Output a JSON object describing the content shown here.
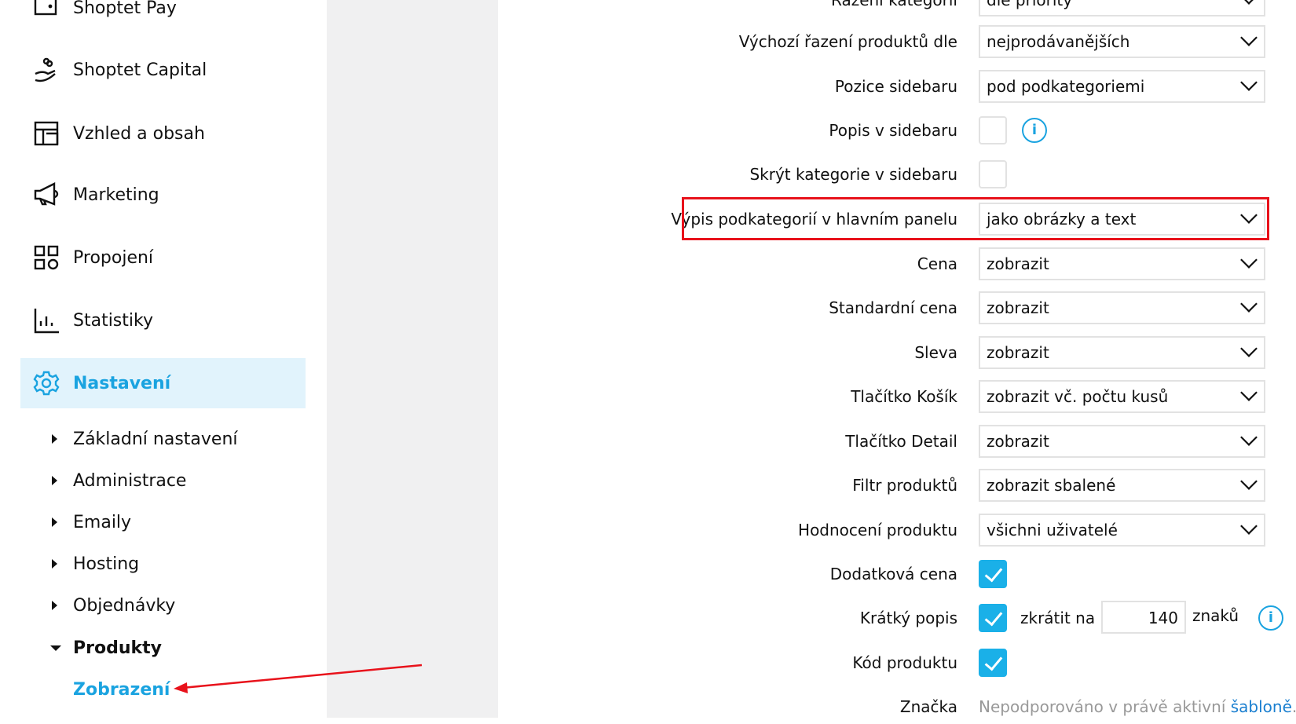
{
  "sidebar": {
    "items": [
      {
        "label": "Shoptet Pay",
        "icon": "wallet-icon"
      },
      {
        "label": "Shoptet Capital",
        "icon": "hand-coins-icon"
      },
      {
        "label": "Vzhled a obsah",
        "icon": "layout-icon"
      },
      {
        "label": "Marketing",
        "icon": "megaphone-icon"
      },
      {
        "label": "Propojení",
        "icon": "apps-icon"
      },
      {
        "label": "Statistiky",
        "icon": "bar-chart-icon"
      },
      {
        "label": "Nastavení",
        "icon": "gear-icon",
        "active": true
      }
    ],
    "subitems": [
      {
        "label": "Základní nastavení"
      },
      {
        "label": "Administrace"
      },
      {
        "label": "Emaily"
      },
      {
        "label": "Hosting"
      },
      {
        "label": "Objednávky"
      },
      {
        "label": "Produkty",
        "expanded": true
      },
      {
        "label": "Zobrazení",
        "active": true
      }
    ]
  },
  "form": {
    "rows": [
      {
        "label": "Řazení kategorií",
        "value": "dle priority"
      },
      {
        "label": "Výchozí řazení produktů dle",
        "value": "nejprodávanějších"
      },
      {
        "label": "Pozice sidebaru",
        "value": "pod podkategoriemi"
      },
      {
        "label": "Popis v sidebaru",
        "checked": false
      },
      {
        "label": "Skrýt kategorie v sidebaru",
        "checked": false
      },
      {
        "label": "Výpis podkategorií v hlavním panelu",
        "value": "jako obrázky a text",
        "highlighted": true
      },
      {
        "label": "Cena",
        "value": "zobrazit"
      },
      {
        "label": "Standardní cena",
        "value": "zobrazit"
      },
      {
        "label": "Sleva",
        "value": "zobrazit"
      },
      {
        "label": "Tlačítko Košík",
        "value": "zobrazit vč. počtu kusů"
      },
      {
        "label": "Tlačítko Detail",
        "value": "zobrazit"
      },
      {
        "label": "Filtr produktů",
        "value": "zobrazit sbalené"
      },
      {
        "label": "Hodnocení produktu",
        "value": "všichni uživatelé"
      },
      {
        "label": "Dodatková cena",
        "checked": true
      },
      {
        "label": "Krátký popis",
        "checked": true,
        "prefix": "zkrátit na",
        "number": "140",
        "suffix": "znaků"
      },
      {
        "label": "Kód produktu",
        "checked": true
      },
      {
        "label": "Značka",
        "note": "Nepodporováno v právě aktivní",
        "link": "šabloně",
        "note_end": ". P"
      }
    ]
  },
  "colors": {
    "accent": "#1aa3e0",
    "highlight": "#e8121b",
    "active_bg": "#e1f3fc"
  }
}
